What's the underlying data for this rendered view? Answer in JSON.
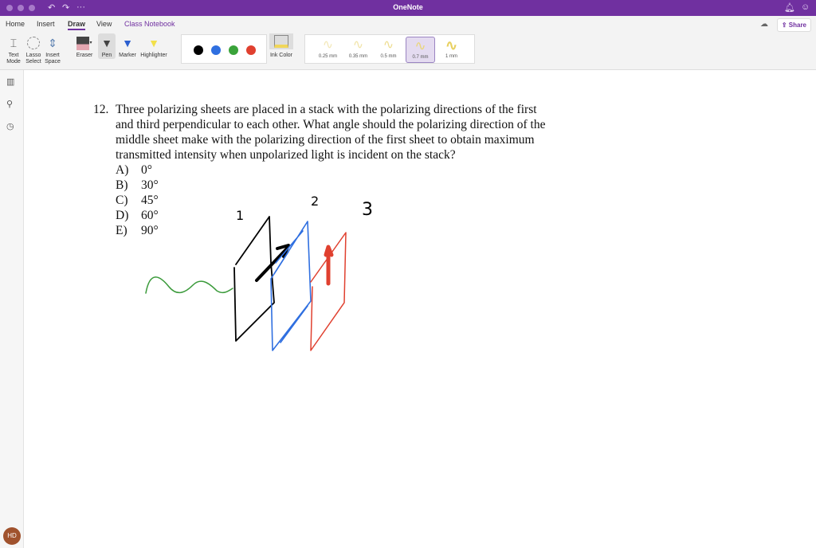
{
  "window": {
    "title": "OneNote"
  },
  "tabs": [
    {
      "label": "Home"
    },
    {
      "label": "Insert"
    },
    {
      "label": "Draw"
    },
    {
      "label": "View"
    },
    {
      "label": "Class Notebook"
    }
  ],
  "tools": {
    "text_mode": "Text Mode",
    "lasso": "Lasso Select",
    "insert_space": "Insert Space",
    "eraser": "Eraser",
    "pen": "Pen",
    "marker": "Marker",
    "highlighter": "Highlighter",
    "ink_color": "Ink Color"
  },
  "colors": [
    "#000000",
    "#2f6fe0",
    "#3aa33a",
    "#e0402f"
  ],
  "thicknesses": [
    {
      "label": "0.25 mm"
    },
    {
      "label": "0.35 mm"
    },
    {
      "label": "0.5 mm"
    },
    {
      "label": "0.7 mm",
      "selected": true
    },
    {
      "label": "1 mm"
    }
  ],
  "share_label": "Share",
  "user_initials": "HD",
  "question": {
    "number": "12.",
    "lines": [
      "Three polarizing sheets are placed in a stack with the polarizing directions of the first",
      "and third perpendicular to each other. What angle should the polarizing direction of the",
      "middle sheet make with the polarizing direction of the first sheet to obtain maximum",
      "transmitted intensity when unpolarized light is incident on the stack?"
    ],
    "options": [
      {
        "letter": "A)",
        "value": "0°"
      },
      {
        "letter": "B)",
        "value": "30°"
      },
      {
        "letter": "C)",
        "value": "45°"
      },
      {
        "letter": "D)",
        "value": "60°"
      },
      {
        "letter": "E)",
        "value": "90°"
      }
    ]
  },
  "sketch_labels": {
    "one": "1",
    "two": "2",
    "three": "3"
  }
}
